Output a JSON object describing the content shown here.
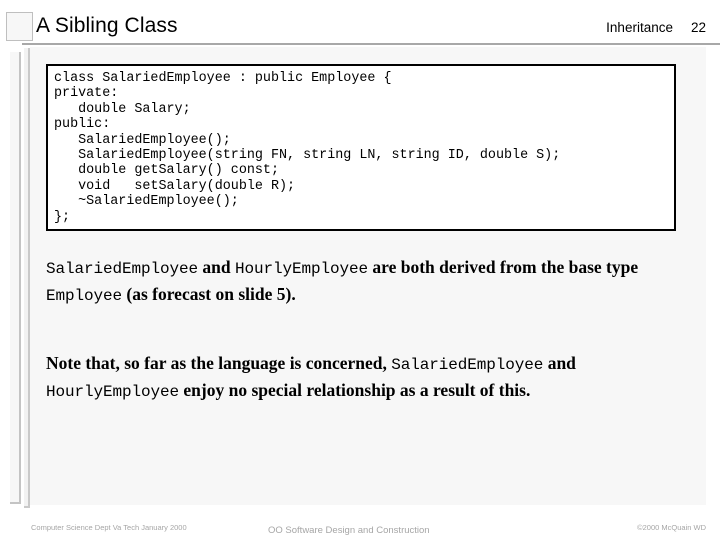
{
  "slide": {
    "title": "A Sibling Class",
    "section": "Inheritance",
    "number": "22"
  },
  "code_block": {
    "language": "cpp",
    "lines": [
      "class SalariedEmployee : public Employee {",
      "private:",
      "   double Salary;",
      "public:",
      "   SalariedEmployee();",
      "   SalariedEmployee(string FN, string LN, string ID, double S);",
      "   double getSalary() const;",
      "   void   setSalary(double R);",
      "   ~SalariedEmployee();",
      "};"
    ],
    "text": "class SalariedEmployee : public Employee {\nprivate:\n   double Salary;\npublic:\n   SalariedEmployee();\n   SalariedEmployee(string FN, string LN, string ID, double S);\n   double getSalary() const;\n   void   setSalary(double R);\n   ~SalariedEmployee();\n};"
  },
  "paragraphs": {
    "first": {
      "seg1_code": "SalariedEmployee",
      "seg2": " and ",
      "seg3_code": "HourlyEmployee",
      "seg4": " are both derived from the base type ",
      "seg5_code": "Employee",
      "seg6": " (as forecast on slide 5)."
    },
    "second": {
      "seg1": "Note that, so far as the language is concerned, ",
      "seg2_code": "SalariedEmployee",
      "seg3": " and ",
      "seg4_code": "HourlyEmployee",
      "seg5": " enjoy no special relationship as a result of this."
    }
  },
  "footer": {
    "left": "Computer Science Dept Va Tech January 2000",
    "center": "OO Software Design and Construction",
    "right": "©2000  McQuain WD"
  },
  "colors": {
    "page_background": "#ffffff",
    "panel_background": "#f7f7f7",
    "rule": "#a8a8a8",
    "code_border": "#000000",
    "text": "#000000",
    "footer_text": "#a6a6a6"
  }
}
